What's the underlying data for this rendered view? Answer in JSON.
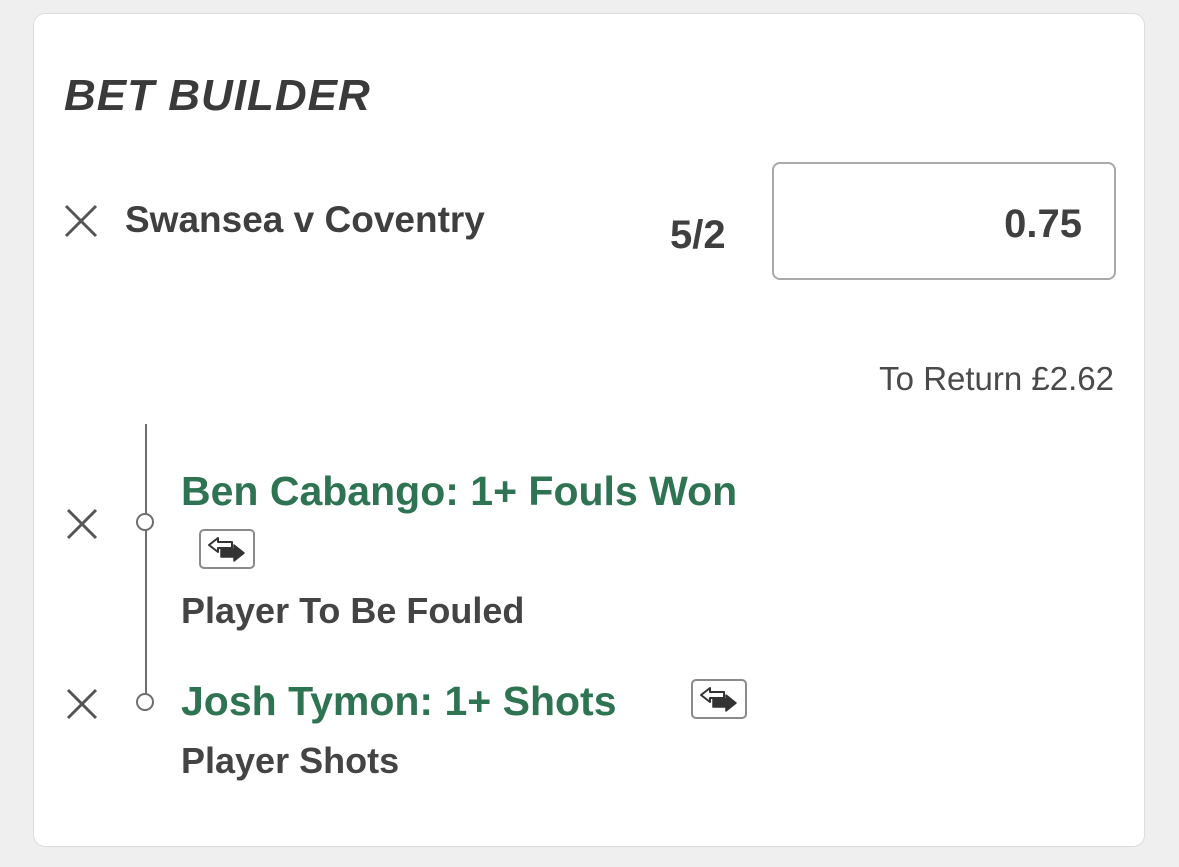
{
  "bet_builder": {
    "title": "BET BUILDER",
    "event": "Swansea v Coventry",
    "odds": "5/2",
    "stake": "0.75",
    "to_return": "To Return £2.62",
    "selections": [
      {
        "title": "Ben Cabango: 1+ Fouls Won",
        "market": "Player To Be Fouled",
        "icon": "swap-icon"
      },
      {
        "title": "Josh Tymon: 1+ Shots",
        "market": "Player Shots",
        "icon": "swap-icon"
      }
    ]
  },
  "colors": {
    "selection_green": "#2e7352",
    "text_dark": "#3a3a3a",
    "background": "#efefef",
    "card": "#ffffff"
  },
  "icons": {
    "remove": "close-icon",
    "swap": "swap-icon"
  }
}
